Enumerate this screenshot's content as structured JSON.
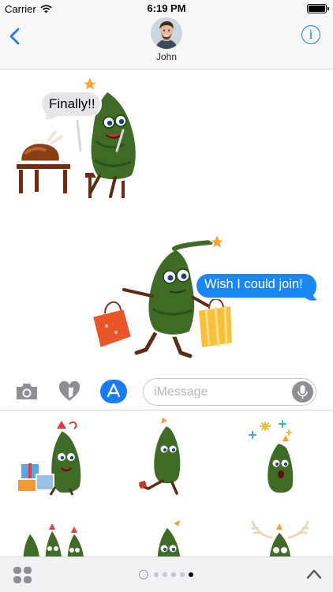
{
  "status_bar": {
    "carrier": "Carrier",
    "time": "6:19 PM"
  },
  "nav": {
    "contact_name": "John",
    "info_label": "i",
    "accent_color": "#1a7cf6"
  },
  "conversation": {
    "received_sticker": {
      "caption": "Finally!!",
      "bubble_color": "#e5e5ea"
    },
    "sent_sticker": {
      "caption": "Wish I could join!",
      "bubble_color": "#1a87f5"
    }
  },
  "input_bar": {
    "placeholder": "iMessage",
    "icons": [
      "camera-icon",
      "digital-touch-icon",
      "app-store-icon",
      "microphone-icon"
    ]
  },
  "sticker_drawer": {
    "stickers": [
      "tree-with-gifts",
      "tree-walking",
      "tree-with-fireworks",
      "trees-group",
      "tree-peeking",
      "tree-with-antlers"
    ]
  },
  "bottom_bar": {
    "page_count": 5,
    "active_page": 4
  }
}
